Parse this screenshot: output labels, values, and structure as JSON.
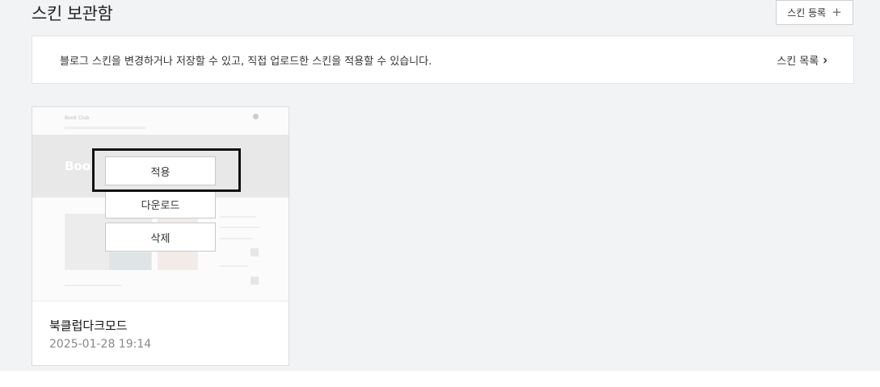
{
  "header": {
    "title": "스킨 보관함",
    "register_label": "스킨 등록",
    "register_icon": "plus-icon"
  },
  "info": {
    "text": "블로그 스킨을 변경하거나 저장할 수 있고, 직접 업로드한 스킨을 적용할 수 있습니다.",
    "link_label": "스킨 목록",
    "link_icon": "chevron-right-icon"
  },
  "skins": [
    {
      "name": "북클럽다크모드",
      "date": "2025-01-28 19:14",
      "actions": {
        "apply": "적용",
        "download": "다운로드",
        "delete": "삭제"
      },
      "thumbnail": {
        "site_title": "Book Club",
        "hero_text": "Boo"
      }
    }
  ],
  "colors": {
    "page_bg": "#f2f3f5",
    "card_bg": "#ffffff",
    "highlight": "#111111"
  }
}
